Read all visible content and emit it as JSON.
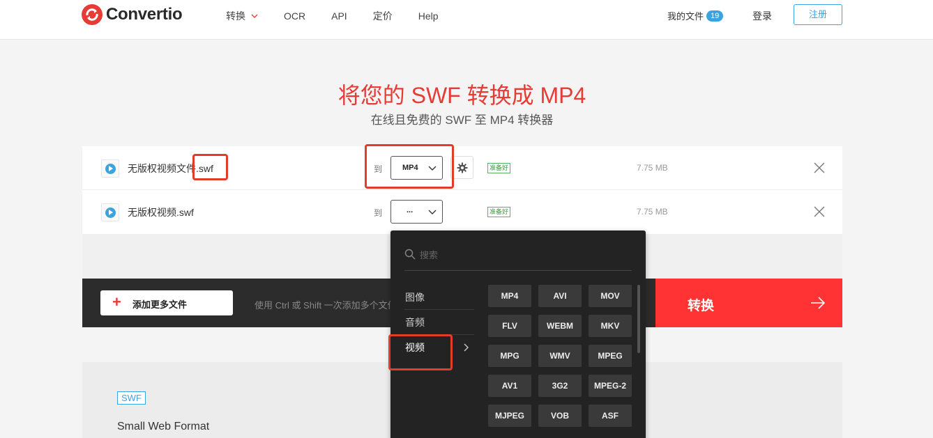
{
  "brand": {
    "name": "Convertio",
    "color": "#e63c35"
  },
  "nav": {
    "items": [
      {
        "label": "转换"
      },
      {
        "label": "OCR"
      },
      {
        "label": "API"
      },
      {
        "label": "定价"
      },
      {
        "label": "Help"
      }
    ]
  },
  "header": {
    "my_files": "我的文件",
    "file_count": "19",
    "login": "登录",
    "register": "注册"
  },
  "hero": {
    "title": "将您的 SWF 转换成 MP4",
    "subtitle": "在线且免费的 SWF 至 MP4 转换器"
  },
  "files": [
    {
      "name_base": "无版权视频文件",
      "name_ext": ".swf",
      "to_label": "到",
      "format": "MP4",
      "status": "准备好",
      "size": "7.75 MB"
    },
    {
      "name": "无版权视频.swf",
      "to_label": "到",
      "format": "...",
      "status": "准备好",
      "size": "7.75 MB"
    }
  ],
  "actions": {
    "add_more": "添加更多文件",
    "hint": "使用 Ctrl 或 Shift 一次添加多个文件",
    "convert": "转换"
  },
  "info": {
    "tag": "SWF",
    "full_name": "Small Web Format"
  },
  "dropdown": {
    "search_placeholder": "搜索",
    "categories": [
      {
        "label": "图像"
      },
      {
        "label": "音频"
      },
      {
        "label": "视频"
      }
    ],
    "active_category": "视频",
    "formats": [
      "MP4",
      "AVI",
      "MOV",
      "FLV",
      "WEBM",
      "MKV",
      "MPG",
      "WMV",
      "MPEG",
      "AV1",
      "3G2",
      "MPEG-2",
      "MJPEG",
      "VOB",
      "ASF"
    ]
  },
  "colors": {
    "accent_blue": "#3aa4e0",
    "convert_red": "#ff3333",
    "ready_green": "#3a9a46",
    "dropdown_bg": "#232323"
  }
}
